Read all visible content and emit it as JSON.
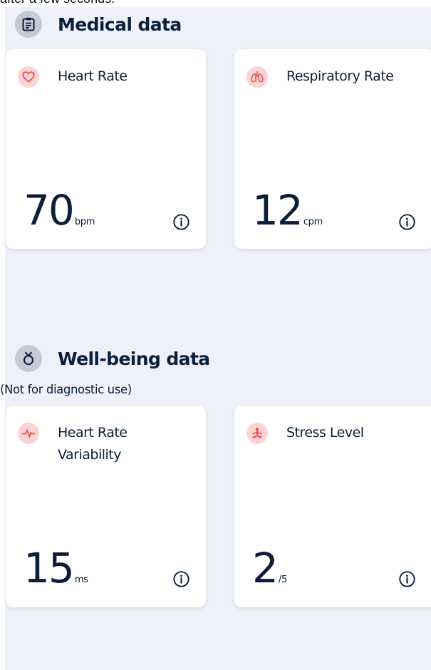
{
  "clipped_top_text": "after a few seconds.",
  "medical": {
    "title": "Medical data",
    "icon": "clipboard-icon",
    "cards": [
      {
        "title": "Heart Rate",
        "value": "70",
        "unit": "bpm",
        "icon": "heart-icon"
      },
      {
        "title": "Respiratory Rate",
        "value": "12",
        "unit": "cpm",
        "icon": "lungs-icon"
      }
    ]
  },
  "wellbeing": {
    "title": "Well-being data",
    "subtitle": "(Not for diagnostic use)",
    "icon": "wellbeing-icon",
    "cards": [
      {
        "title_line1": "Heart Rate",
        "title_line2": "Variability",
        "value": "15",
        "unit": "ms",
        "icon": "pulse-icon"
      },
      {
        "title": "Stress Level",
        "value": "2",
        "unit": "/5",
        "icon": "meditation-icon"
      }
    ]
  },
  "colors": {
    "panel_background": "#eef0fa",
    "text_primary": "#0b1f3a",
    "icon_badge_background": "#fbd3d3",
    "icon_accent": "#e8505b",
    "section_icon_background": "#c5cad6"
  }
}
